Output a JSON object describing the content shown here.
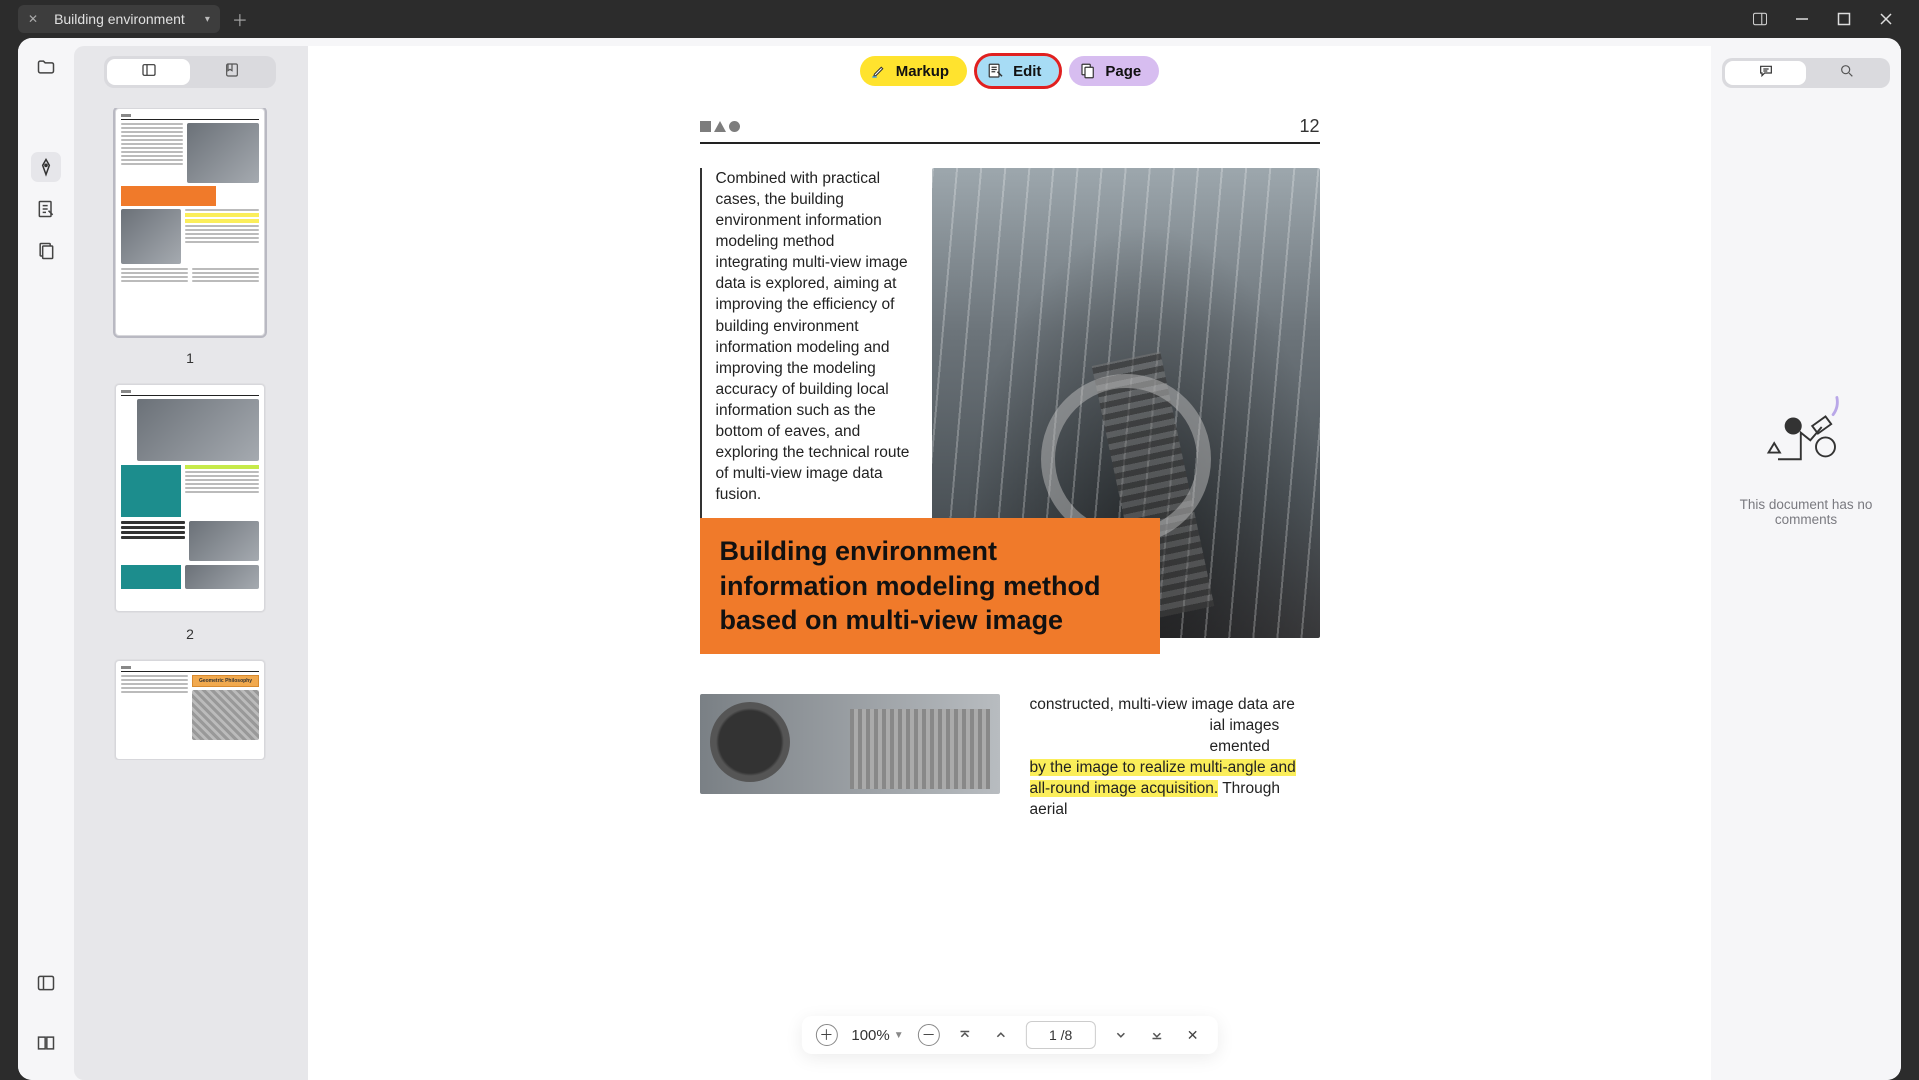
{
  "tab": {
    "title": "Building environment"
  },
  "mode_bar": {
    "markup": "Markup",
    "edit": "Edit",
    "page": "Page"
  },
  "thumbnails": {
    "page_labels": [
      "1",
      "2"
    ]
  },
  "document": {
    "page_number": "12",
    "intro_text": "Combined with practical cases, the building environment information modeling method integrating multi-view image data is explored, aiming at improving the efficiency of building environment information modeling and improving the modeling accuracy of building local information such as the bottom of eaves, and exploring the technical route of multi-view image data fusion.",
    "title": "Building environment information modeling method based on multi-view image",
    "lower_leading": "constructed, multi-view image data are ",
    "lower_mid1": "ial images ",
    "lower_mid2": "emented ",
    "lower_highlight": "by the image to realize multi-angle and all-round image acquisition.",
    "lower_trailing": " Through aerial"
  },
  "page_nav": {
    "zoom": "100%",
    "page_field": "1 /8"
  },
  "comments": {
    "empty_text": "This document has no comments"
  }
}
